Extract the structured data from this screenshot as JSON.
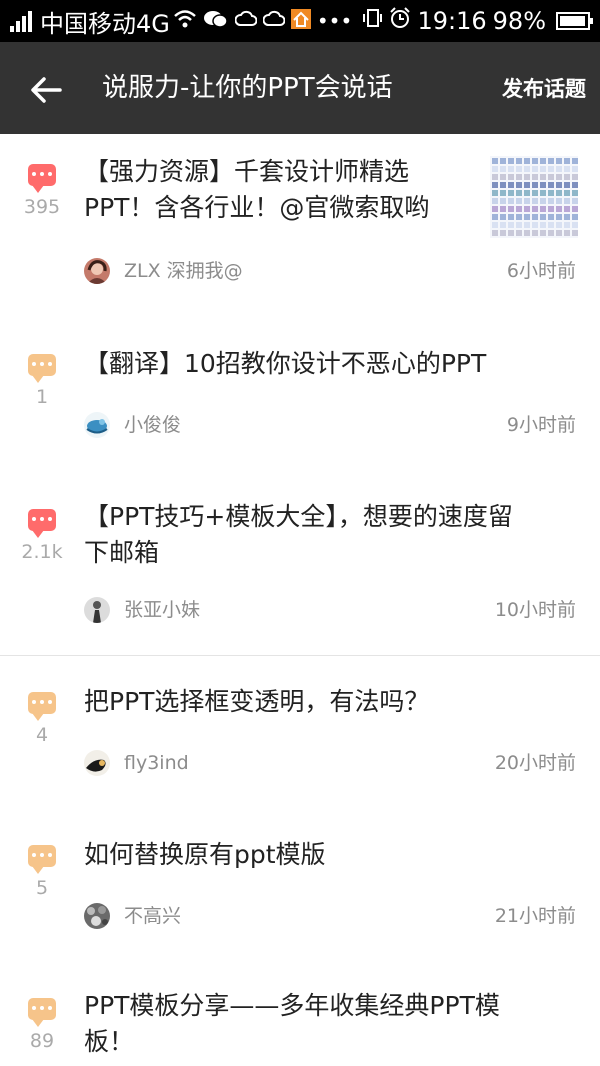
{
  "status_bar": {
    "carrier": "中国移动4G",
    "time": "19:16",
    "battery": "98%",
    "battery_level": 0.98
  },
  "header": {
    "back_icon": "arrow-left-icon",
    "title": "说服力-让你的PPT会说话",
    "action_label": "发布话题"
  },
  "colors": {
    "status_bar_bg": "#000000",
    "header_bg": "#333333",
    "bubble_red": "#ff6b6b",
    "bubble_orange": "#f6c48a",
    "meta_text": "#8c8c8c"
  },
  "topics": [
    {
      "title_line1": "【强力资源】千套设计师精选",
      "title_line2": "PPT！含各行业！@官微索取哟",
      "count": "395",
      "author": "ZLX 深拥我@",
      "time": "6小时前",
      "bubble": "red",
      "has_thumbnail": true
    },
    {
      "title_line1": "【翻译】10招教你设计不恶心的PPT",
      "title_line2": "",
      "count": "1",
      "author": "小俊俊",
      "time": "9小时前",
      "bubble": "orange",
      "has_thumbnail": false
    },
    {
      "title_line1": "【PPT技巧+模板大全】，想要的速度留",
      "title_line2": "下邮箱",
      "count": "2.1k",
      "author": "张亚小妹",
      "time": "10小时前",
      "bubble": "red",
      "has_thumbnail": false
    },
    {
      "title_line1": "把PPT选择框变透明，有法吗？",
      "title_line2": "",
      "count": "4",
      "author": "fly3ind",
      "time": "20小时前",
      "bubble": "orange",
      "has_thumbnail": false
    },
    {
      "title_line1": "如何替换原有ppt模版",
      "title_line2": "",
      "count": "5",
      "author": "不高兴",
      "time": "21小时前",
      "bubble": "orange",
      "has_thumbnail": false
    },
    {
      "title_line1": "PPT模板分享——多年收集经典PPT模",
      "title_line2": "板！",
      "count": "89",
      "author": "",
      "time": "",
      "bubble": "orange",
      "has_thumbnail": false
    }
  ]
}
